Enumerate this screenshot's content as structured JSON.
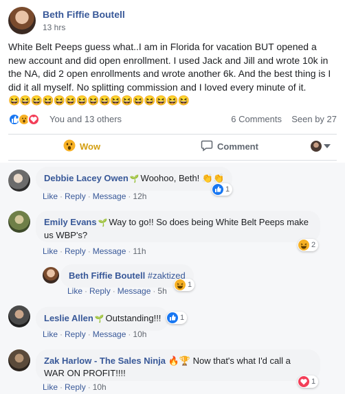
{
  "post": {
    "author": "Beth Fiffie Boutell",
    "time": "13 hrs",
    "text": "White Belt Peeps guess what..I am in Florida for vacation BUT opened a new account and did open enrollment. I used Jack and Jill and wrote 10k in the NA, did 2 open enrollments and wrote another 6k. And the best thing is I did it all myself. No splitting commission and I loved every minute of it.",
    "emoji_tail": "😆😆😆😆😆😆😆😆😆😆😆😆😆😆😆😆",
    "reactions_text": "You and 13 others",
    "comments_count": "6 Comments",
    "seen_by": "Seen by 27",
    "reaction_icons": [
      "like-icon",
      "wow-icon",
      "love-icon"
    ]
  },
  "actions": {
    "wow_label": "Wow",
    "comment_label": "Comment"
  },
  "comment_actions": {
    "like": "Like",
    "reply": "Reply",
    "message": "Message"
  },
  "comments": [
    {
      "author": "Debbie Lacey Owen",
      "text": "Woohoo, Beth!",
      "trailing_emoji": "👏👏",
      "time": "12h",
      "reaction_count": "1",
      "reaction_icon": "like-icon"
    },
    {
      "author": "Emily Evans",
      "text": "Way to go!! So does being White Belt Peeps make us WBP's?",
      "time": "11h",
      "reaction_count": "2",
      "reaction_icon": "haha-icon"
    },
    {
      "author": "Beth Fiffie Boutell",
      "tag": "#zaktized",
      "time": "5h",
      "reaction_count": "1",
      "reaction_icon": "haha-icon"
    },
    {
      "author": "Leslie Allen",
      "text": "Outstanding!!!",
      "time": "10h",
      "reaction_count": "1",
      "reaction_icon": "like-icon"
    },
    {
      "author": "Zak Harlow - The Sales Ninja",
      "author_emoji": "🔥🏆",
      "text": "Now that's what I'd call a WAR ON PROFIT!!!!",
      "time": "10h",
      "reaction_count": "1",
      "reaction_icon": "love-icon"
    }
  ],
  "colors": {
    "link_blue": "#385898",
    "like_blue": "#1877f2",
    "wow_yellow": "#f7b125",
    "love_red": "#f33e58",
    "bubble_grey": "#f2f3f5"
  }
}
